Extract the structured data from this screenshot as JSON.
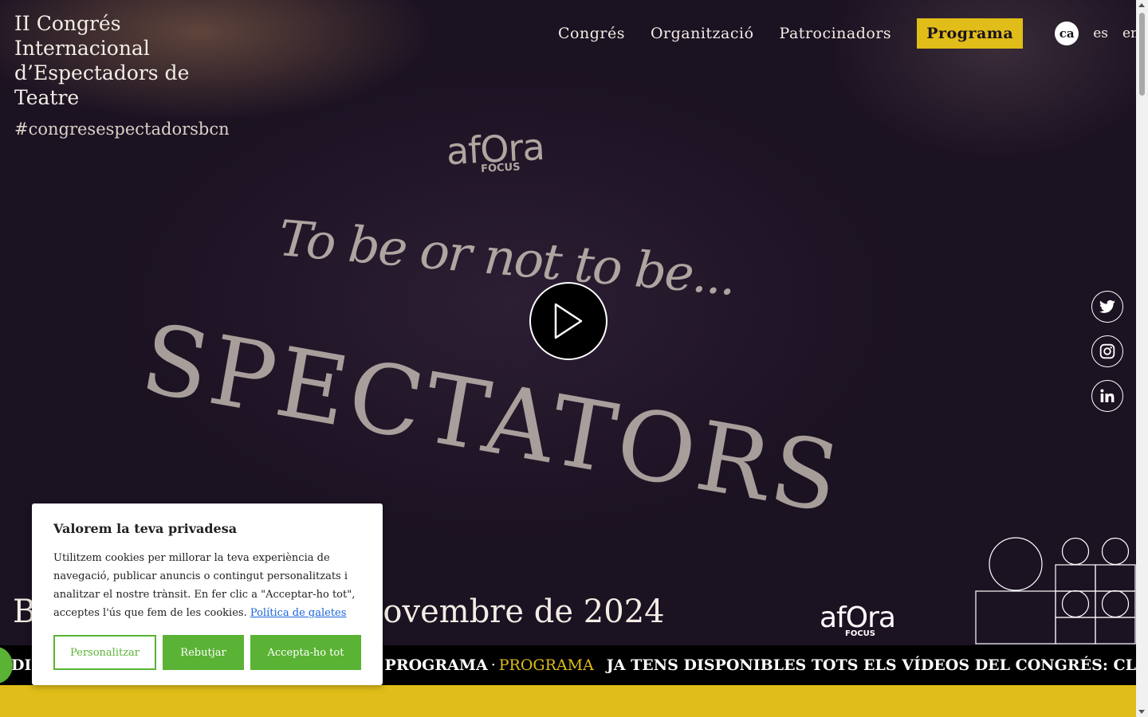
{
  "site": {
    "title": "II Congrés Internacional d’Espectadors de Teatre",
    "hashtag": "#congresespectadorsbcn"
  },
  "nav": {
    "items": [
      "Congrés",
      "Organització",
      "Patrocinadors"
    ],
    "program_label": "Programa",
    "languages": [
      {
        "code": "ca",
        "active": true
      },
      {
        "code": "es",
        "active": false
      },
      {
        "code": "en",
        "active": false
      }
    ]
  },
  "hero": {
    "shirt_logo": "afOra",
    "shirt_logo_sub": "FOCUS",
    "shirt_line": "To be or not to be...",
    "shirt_big": "SPECTATORS",
    "date_text": "Barcelona, 14, 15 i 16 de novembre de 2024",
    "date_visible_start": "B",
    "date_visible_end": "ovembre de 2024",
    "play_icon": "play-icon"
  },
  "social": [
    "twitter-icon",
    "instagram-icon",
    "linkedin-icon"
  ],
  "sponsor": {
    "name": "afOra",
    "sub": "FOCUS"
  },
  "ticker": {
    "text_start": "DIS",
    "text_mid": "S: CLICA A PROGRAMA",
    "separator": "·",
    "link": "PROGRAMA",
    "text_repeat": "JA TENS DISPONIBLES TOTS ELS VÍDEOS DEL CONGRÉS: CL"
  },
  "cookie": {
    "title": "Valorem la teva privadesa",
    "body": "Utilitzem cookies per millorar la teva experiència de navegació, publicar anuncis o contingut personalitzats i analitzar el nostre trànsit. En fer clic a \"Acceptar-ho tot\", acceptes l'ús que fem de les cookies.",
    "policy_link": "Política de galetes",
    "customize": "Personalitzar",
    "reject": "Rebutjar",
    "accept": "Accepta-ho tot"
  },
  "colors": {
    "accent_yellow": "#e0bd18",
    "cookie_green": "#5ab334",
    "link_blue": "#1863dc",
    "background": "#1b1222"
  }
}
